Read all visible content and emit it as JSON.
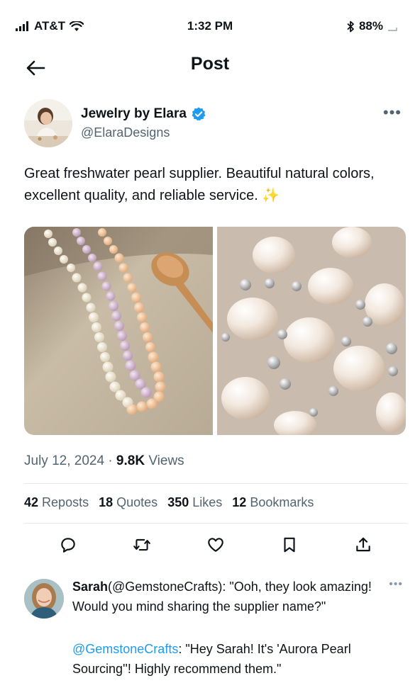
{
  "status_bar": {
    "carrier": "AT&T",
    "time": "1:32 PM",
    "battery": "88%"
  },
  "nav": {
    "title": "Post"
  },
  "post": {
    "author_name": "Jewelry by Elara",
    "author_handle": "@ElaraDesigns",
    "text": "Great freshwater pearl supplier. Beautiful natural colors, excellent quality, and reliable service.",
    "emoji": "✨",
    "date": "July 12, 2024",
    "separator": "·",
    "views_count": "9.8K",
    "views_label": "Views",
    "stats": [
      {
        "count": "42",
        "label": "Reposts"
      },
      {
        "count": "18",
        "label": "Quotes"
      },
      {
        "count": "350",
        "label": "Likes"
      },
      {
        "count": "12",
        "label": "Bookmarks"
      }
    ],
    "images": [
      "pearl-necklaces-with-wooden-spoon",
      "baroque-pearls-with-silver-beads"
    ]
  },
  "actions": [
    "reply-icon",
    "repost-icon",
    "like-icon",
    "bookmark-icon",
    "share-icon"
  ],
  "reply": {
    "name": "Sarah",
    "handle_in_parens": "(@GemstoneCrafts)",
    "text": ": \"Ooh, they look amazing! Would you mind sharing the supplier name?\"",
    "response_mention": "@GemstoneCrafts",
    "response_text": ": \"Hey Sarah! It's 'Aurora Pearl Sourcing''! Highly recommend them.\""
  },
  "colors": {
    "accent": "#1d9bf0",
    "text": "#0f1419",
    "secondary": "#536471"
  }
}
